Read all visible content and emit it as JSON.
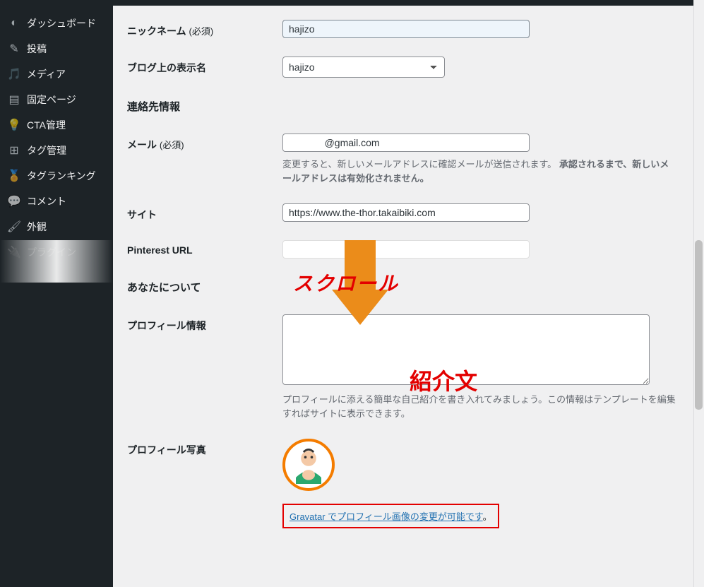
{
  "sidebar": {
    "items": [
      {
        "icon": "dashboard-icon",
        "glyph": "◐",
        "label": "ダッシュボード"
      },
      {
        "icon": "posts-icon",
        "glyph": "✎",
        "label": "投稿"
      },
      {
        "icon": "media-icon",
        "glyph": "🎵",
        "label": "メディア"
      },
      {
        "icon": "pages-icon",
        "glyph": "▤",
        "label": "固定ページ"
      },
      {
        "icon": "cta-icon",
        "glyph": "💡",
        "label": "CTA管理"
      },
      {
        "icon": "tag-icon",
        "glyph": "⊞",
        "label": "タグ管理"
      },
      {
        "icon": "tagrank-icon",
        "glyph": "🏅",
        "label": "タグランキング"
      },
      {
        "icon": "comments-icon",
        "glyph": "💬",
        "label": "コメント"
      },
      {
        "icon": "appearance-icon",
        "glyph": "🖌",
        "label": "外観"
      },
      {
        "icon": "plugins-icon",
        "glyph": "🔌",
        "label": "プラグイン"
      }
    ]
  },
  "fields": {
    "nickname_label": "ニックネーム",
    "nickname_req": "(必須)",
    "nickname_value": "hajizo",
    "displayname_label": "ブログ上の表示名",
    "displayname_value": "hajizo",
    "contact_heading": "連絡先情報",
    "email_label": "メール",
    "email_req": "(必須)",
    "email_value": "             @gmail.com",
    "email_desc_1": "変更すると、新しいメールアドレスに確認メールが送信されます。",
    "email_desc_2": "承認されるまで、新しいメールアドレスは有効化されません。",
    "site_label": "サイト",
    "site_value": "https://www.the-thor.takaibiki.com",
    "pinterest_label": "Pinterest URL",
    "pinterest_value": "",
    "about_heading": "あなたについて",
    "bio_label": "プロフィール情報",
    "bio_value": "",
    "bio_desc": "プロフィールに添える簡単な自己紹介を書き入れてみましょう。この情報はテンプレートを編集すればサイトに表示できます。",
    "photo_label": "プロフィール写真",
    "gravatar_link": "Gravatar でプロフィール画像の変更が可能です",
    "gravatar_period": "。"
  },
  "annotations": {
    "scroll": "スクロール",
    "bio": "紹介文"
  }
}
